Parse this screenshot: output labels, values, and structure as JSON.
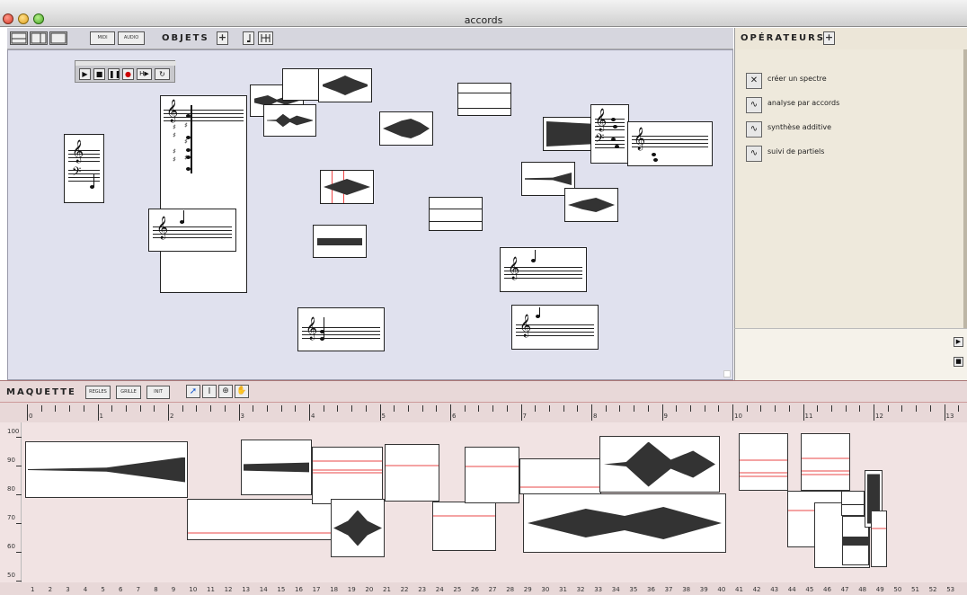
{
  "window": {
    "title": "accords"
  },
  "objects_toolbar": {
    "title": "OBJETS",
    "midi": "MIDI",
    "audio": "AUDIO",
    "add": "+"
  },
  "operators": {
    "title": "OPÉRATEURS",
    "add": "+",
    "items": [
      {
        "label": "créer un spectre",
        "icon": "spectrum-icon"
      },
      {
        "label": "analyse par accords",
        "icon": "chord-analysis-icon"
      },
      {
        "label": "synthèse additive",
        "icon": "additive-synthesis-icon"
      },
      {
        "label": "suivi de partiels",
        "icon": "partial-tracking-icon"
      }
    ]
  },
  "maquette": {
    "title": "MAQUETTE",
    "regles": "REGLES",
    "grille": "GRILLE",
    "init": "INIT"
  },
  "ruler_top": {
    "labels": [
      "0",
      "1",
      "2",
      "3",
      "4",
      "5",
      "6",
      "7",
      "8",
      "9",
      "10",
      "11",
      "12",
      "13"
    ]
  },
  "ruler_left": {
    "labels": [
      "100",
      "90",
      "80",
      "70",
      "60",
      "50"
    ]
  },
  "ruler_bottom": {
    "labels": [
      "1",
      "2",
      "3",
      "4",
      "5",
      "6",
      "7",
      "8",
      "9",
      "10",
      "11",
      "12",
      "13",
      "14",
      "15",
      "16",
      "17",
      "18",
      "19",
      "20",
      "21",
      "22",
      "23",
      "24",
      "25",
      "26",
      "27",
      "28",
      "29",
      "30",
      "31",
      "32",
      "33",
      "34",
      "35",
      "36",
      "37",
      "38",
      "39",
      "40",
      "41",
      "42",
      "43",
      "44",
      "45",
      "46",
      "47",
      "48",
      "49",
      "50",
      "51",
      "52",
      "53"
    ]
  }
}
